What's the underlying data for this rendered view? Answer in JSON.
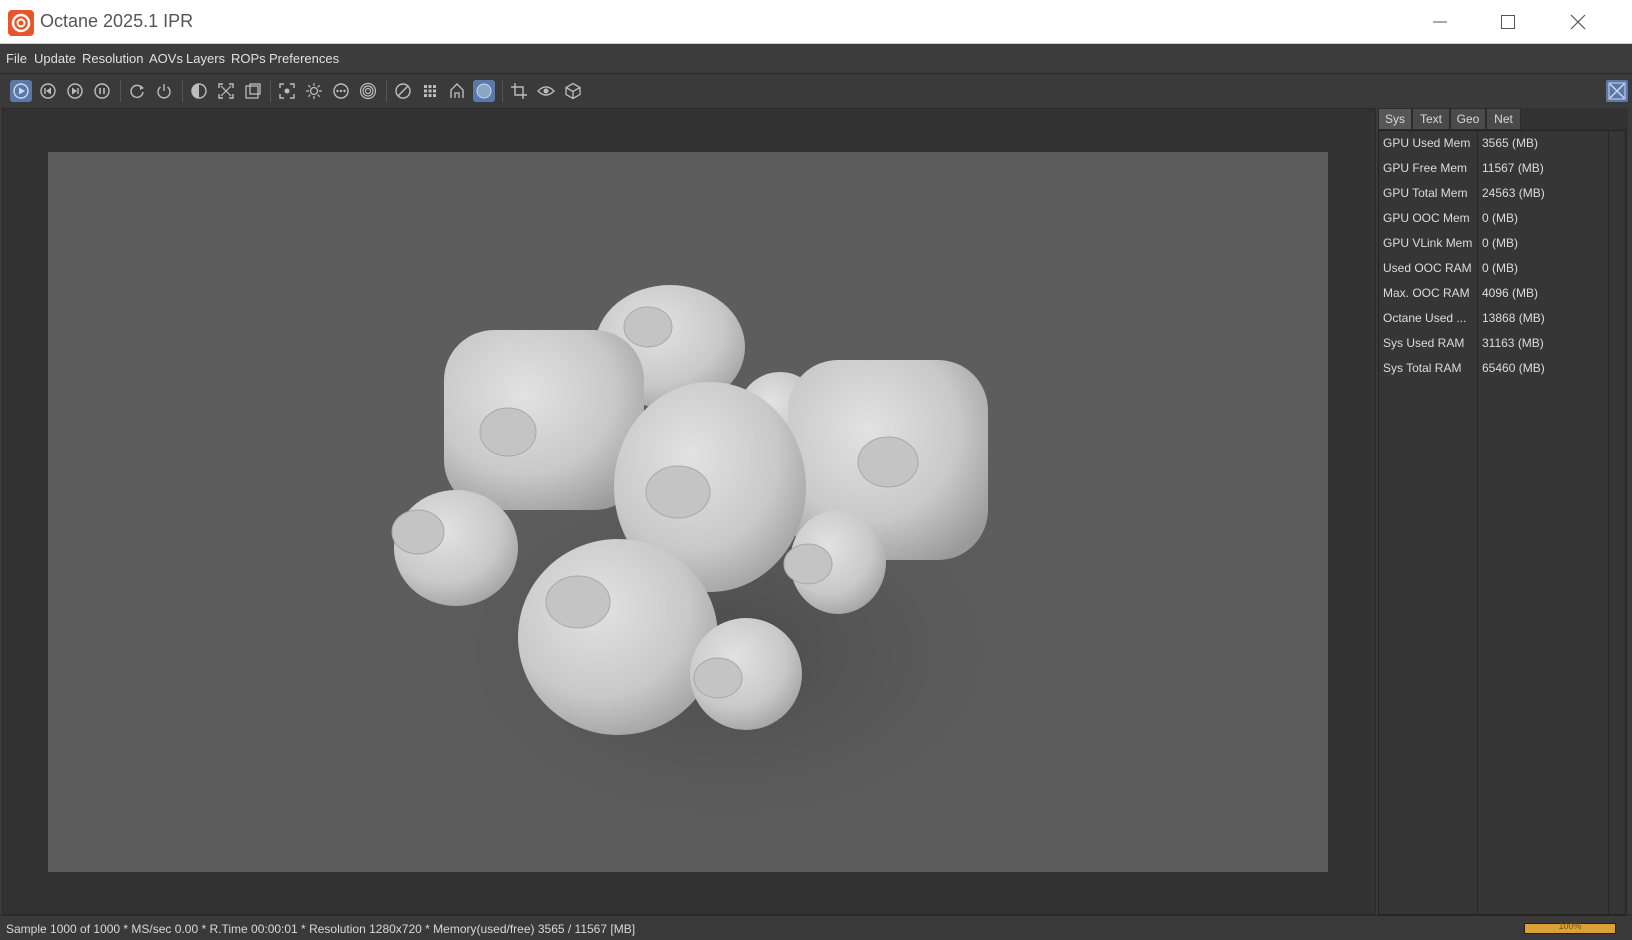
{
  "window": {
    "title": "Octane 2025.1 IPR"
  },
  "menu": [
    "File",
    "Update",
    "Resolution",
    "AOVs",
    "Layers",
    "ROPs",
    "Preferences"
  ],
  "toolbar_icons": [
    "render-icon",
    "prev-icon",
    "next-icon",
    "pause-icon",
    "refresh-icon",
    "power-icon",
    "contrast-icon",
    "fit-icon",
    "region-icon",
    "focus-icon",
    "sun-icon",
    "dots-icon",
    "target-icon",
    "clay-icon",
    "grid-icon",
    "home-icon",
    "sphere-icon",
    "crop-icon",
    "pick-icon",
    "cube-icon"
  ],
  "stats": {
    "tabs": [
      "Sys",
      "Text",
      "Geo",
      "Net"
    ],
    "active_tab": "Sys",
    "rows": [
      {
        "key": "GPU Used Mem",
        "value": "3565 (MB)"
      },
      {
        "key": "GPU Free Mem",
        "value": "11567 (MB)"
      },
      {
        "key": "GPU Total Mem",
        "value": "24563 (MB)"
      },
      {
        "key": "GPU OOC Mem",
        "value": "0 (MB)"
      },
      {
        "key": "GPU VLink Mem",
        "value": "0 (MB)"
      },
      {
        "key": "Used OOC RAM",
        "value": "0 (MB)"
      },
      {
        "key": "Max. OOC RAM",
        "value": "4096 (MB)"
      },
      {
        "key": "Octane Used ...",
        "value": "13868 (MB)"
      },
      {
        "key": "Sys Used RAM",
        "value": "31163 (MB)"
      },
      {
        "key": "Sys Total RAM",
        "value": "65460 (MB)"
      }
    ]
  },
  "status": {
    "text": "Sample 1000 of 1000 * MS/sec 0.00 * R.Time 00:00:01 * Resolution 1280x720 * Memory(used/free) 3565 / 11567 [MB]",
    "progress_percent": 100,
    "progress_label": "100%"
  },
  "colors": {
    "accent": "#5b79a8",
    "progress": "#d9a233",
    "app_icon": "#e8552a"
  }
}
